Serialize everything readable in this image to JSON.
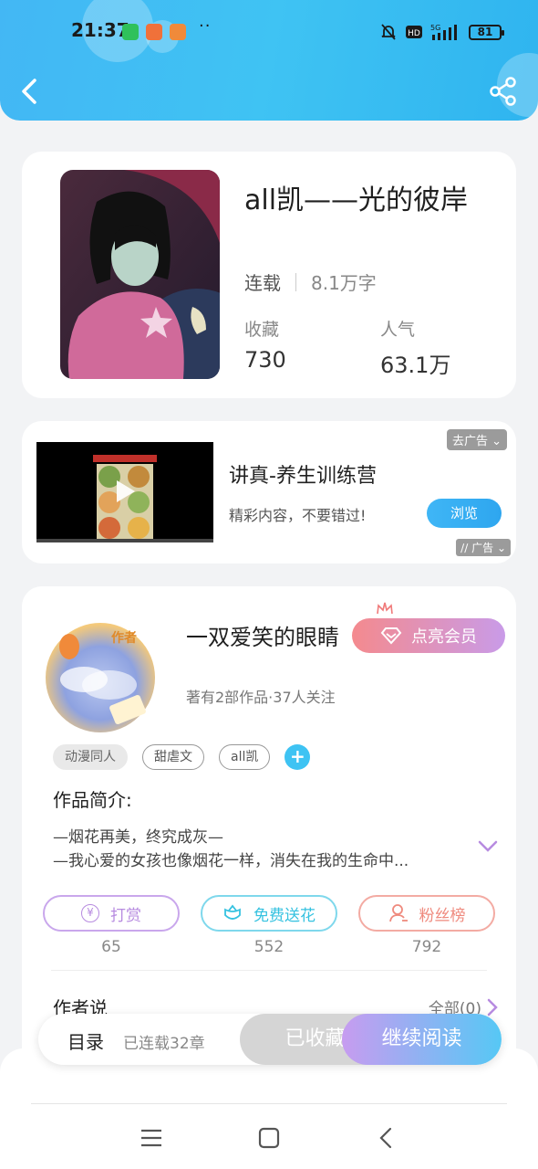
{
  "status_bar": {
    "time": "21:37",
    "dots": "··",
    "battery": "81"
  },
  "book": {
    "title": "all凯——光的彼岸",
    "status": "连载",
    "word_count": "8.1万字",
    "favorites_label": "收藏",
    "favorites_value": "730",
    "popularity_label": "人气",
    "popularity_value": "63.1万"
  },
  "ad": {
    "title": "讲真-养生训练营",
    "desc": "精彩内容，不要错过!",
    "browse": "浏览",
    "remove_ad": "去广告",
    "ad_tag": "广告"
  },
  "author": {
    "badge": "作者",
    "name": "一双爱笑的眼睛",
    "vip_button": "点亮会员",
    "meta": "著有2部作品·37人关注",
    "tags": [
      "动漫同人",
      "甜虐文",
      "all凯"
    ],
    "tag_add": "+",
    "intro_heading": "作品简介:",
    "intro_line1": "—烟花再美，终究成灰—",
    "intro_line2": "—我心爱的女孩也像烟花一样，消失在我的生命中...",
    "actions": {
      "reward": {
        "label": "打赏",
        "count": "65",
        "icon_char": "¥"
      },
      "flower": {
        "label": "免费送花",
        "count": "552"
      },
      "fans": {
        "label": "粉丝榜",
        "count": "792"
      }
    },
    "author_says": "作者说",
    "all_link": "全部(0)"
  },
  "bottom_bar": {
    "toc": "目录",
    "chapters": "已连载32章",
    "collected": "已收藏",
    "continue": "继续阅读"
  },
  "colors": {
    "accent_blue": "#3ec3f3",
    "purple": "#c79cf0",
    "vip_pink": "#f48a8e",
    "reward_purple": "#b78be0",
    "flower_cyan": "#35c2e0",
    "fans_red": "#ef8a7e"
  }
}
